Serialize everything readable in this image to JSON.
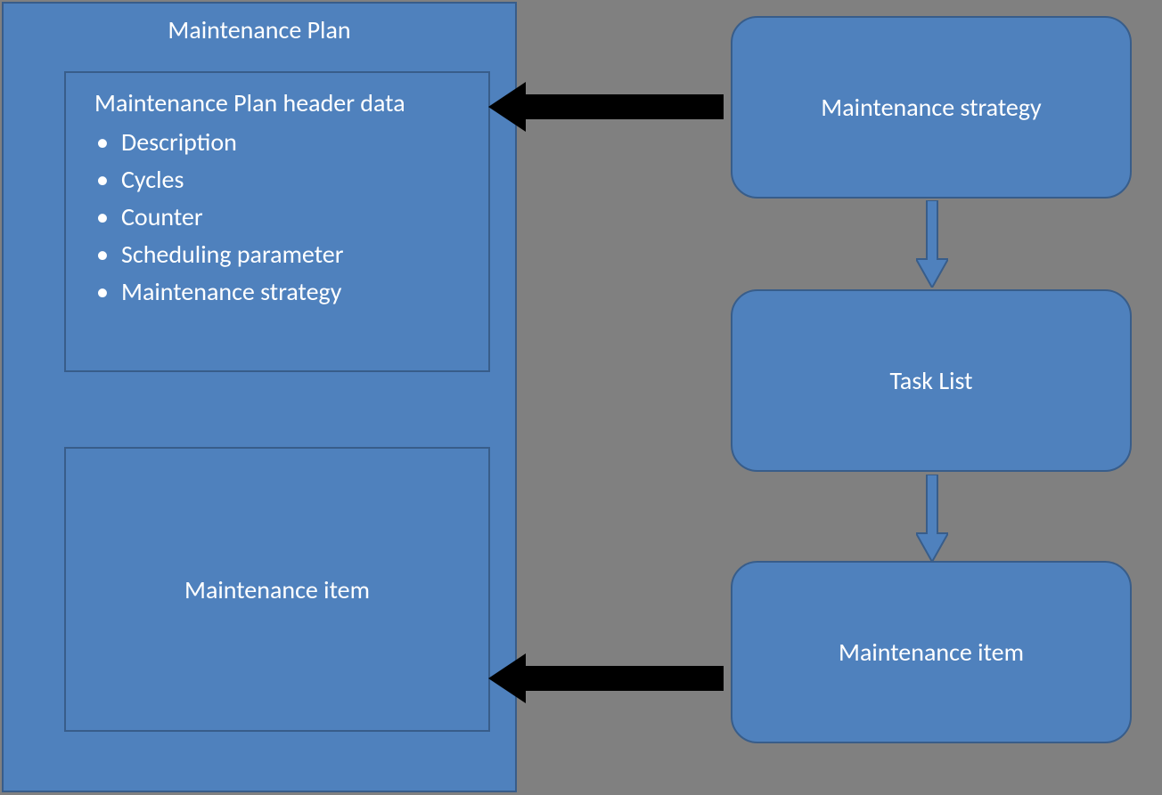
{
  "plan": {
    "title": "Maintenance Plan",
    "header_data": {
      "title": "Maintenance Plan header data",
      "items": [
        "Description",
        "Cycles",
        "Counter",
        "Scheduling parameter",
        "Maintenance strategy"
      ]
    },
    "item_box_title": "Maintenance item"
  },
  "right": {
    "strategy": "Maintenance strategy",
    "task_list": "Task List",
    "item": "Maintenance item"
  }
}
